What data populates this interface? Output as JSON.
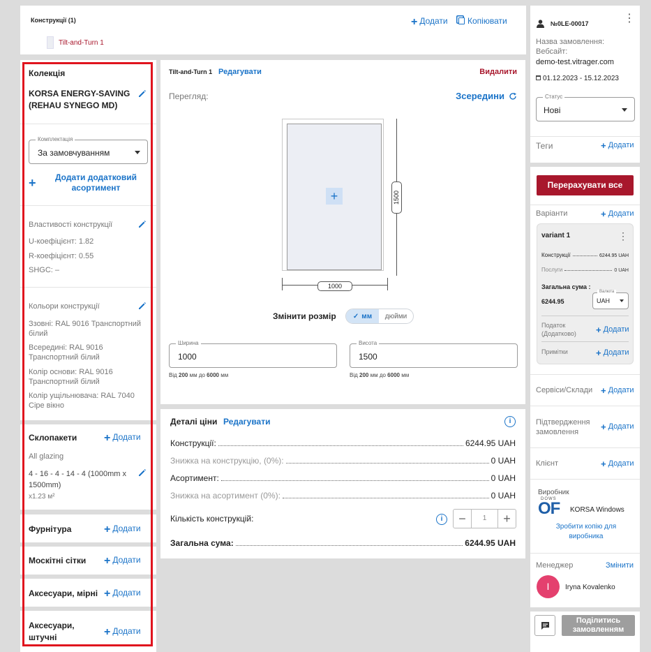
{
  "top": {
    "constructions_label": "Конструкції (1)",
    "add_label": "Додати",
    "copy_label": "Копіювати",
    "item_label": "Tilt-and-Turn 1"
  },
  "left": {
    "collection_title": "Колекція",
    "collection_name": "KORSA ENERGY-SAVING (REHAU SYNEGO MD)",
    "kit_label": "Комплектація",
    "kit_value": "За замовчуванням",
    "add_assortment": "Додати додатковий асортимент",
    "props_title": "Властивості конструкції",
    "u_coef": "U-коефіцієнт: 1.82",
    "r_coef": "R-коефіцієнт: 0.55",
    "shgc": "SHGC: –",
    "colors_title": "Кольори конструкції",
    "color_outside": "Ззовні: RAL 9016 Транспортний білий",
    "color_inside": "Всередині: RAL 9016 Транспортний білий",
    "color_base": "Колір основи: RAL 9016 Транспортний білий",
    "color_seal": "Колір ущільнювача: RAL 7040 Сіре вікно",
    "glass_title": "Склопакети",
    "glass_all": "All glazing",
    "glass_spec": "4 - 16 - 4 - 14 - 4 (1000mm x 1500mm)",
    "glass_area": "x1.23 м²",
    "hardware_title": "Фурнітура",
    "nets_title": "Москітні сітки",
    "acc_measured_title": "Аксесуари, мірні",
    "acc_piece_title": "Аксесуари, штучні",
    "add_label": "Додати",
    "highlight_color": "#e0141e"
  },
  "center": {
    "item_title": "Tilt-and-Turn 1",
    "edit_label": "Редагувати",
    "delete_label": "Видалити",
    "view_label": "Перегляд:",
    "view_mode": "Зсередини",
    "dim_height": "1500",
    "dim_width": "1000",
    "resize_label": "Змінити розмір",
    "unit_mm": "мм",
    "unit_in": "дюйми",
    "width_label": "Ширина",
    "width_value": "1000",
    "width_hint_pre": "Від ",
    "width_min": "200",
    "width_mid": " мм до ",
    "width_max": "6000",
    "width_hint_post": " мм",
    "height_label": "Висота",
    "height_value": "1500",
    "height_hint_pre": "Від ",
    "height_min": "200",
    "height_mid": " мм до ",
    "height_max": "6000",
    "height_hint_post": " мм"
  },
  "price": {
    "title": "Деталі ціни",
    "edit_label": "Редагувати",
    "rows": [
      {
        "label": "Конструкції:",
        "value": "6244.95 UAH"
      },
      {
        "label": "Знижка на конструкцію, (0%):",
        "value": "0 UAH"
      },
      {
        "label": "Асортимент:",
        "value": "0 UAH"
      },
      {
        "label": "Знижка на асортимент (0%):",
        "value": "0 UAH"
      }
    ],
    "qty_label": "Кількість конструкцій:",
    "qty_value": "1",
    "total_label": "Загальна сума:",
    "total_value": "6244.95 UAH"
  },
  "right": {
    "order_no": "№0LE-00017",
    "order_name_label": "Назва замовлення:",
    "website_label": "Вебсайт:",
    "website": "demo-test.vitrager.com",
    "dates": "01.12.2023 - 15.12.2023",
    "status_label": "Статус",
    "status_value": "Нові",
    "tags_label": "Теги",
    "add_label": "Додати",
    "recalc_label": "Перерахувати все",
    "variants_label": "Варіанти",
    "variant_name": "variant 1",
    "v_constr_label": "Конструкції",
    "v_constr_value": "6244.95 UAH",
    "v_serv_label": "Послуги",
    "v_serv_value": "0 UAH",
    "v_total_label": "Загальна сума :",
    "v_total_value": "6244.95",
    "currency_label": "Валюта",
    "currency_value": "UAH",
    "tax_label": "Податок (Додатково)",
    "notes_label": "Примітки",
    "services_label": "Сервіси/Склади",
    "confirm_label": "Підтвердження замовлення",
    "client_label": "Клієнт",
    "maker_label": "Виробник",
    "maker_name": "KORSA Windows",
    "maker_logo_top": "DOWS",
    "maker_logo": "OF",
    "copy_for_maker": "Зробити копію для виробника",
    "manager_label": "Менеджер",
    "change_label": "Змінити",
    "manager_initial": "I",
    "manager_name": "Iryna Kovalenko",
    "share_label": "Поділитись замовленням",
    "recalc_color": "#a8172c",
    "avatar_color": "#e4406e"
  }
}
